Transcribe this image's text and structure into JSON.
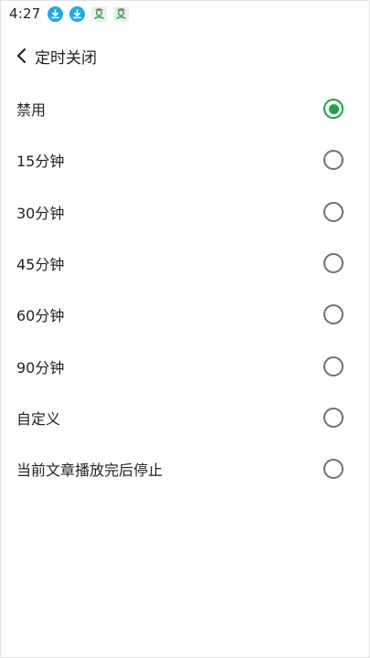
{
  "status_bar": {
    "time": "4:27",
    "icons": [
      "download-icon",
      "download-icon",
      "app-icon",
      "app-icon"
    ]
  },
  "header": {
    "title": "定时关闭"
  },
  "options": [
    {
      "label": "禁用",
      "selected": true
    },
    {
      "label": "15分钟",
      "selected": false
    },
    {
      "label": "30分钟",
      "selected": false
    },
    {
      "label": "45分钟",
      "selected": false
    },
    {
      "label": "60分钟",
      "selected": false
    },
    {
      "label": "90分钟",
      "selected": false
    },
    {
      "label": "自定义",
      "selected": false
    },
    {
      "label": "当前文章播放完后停止",
      "selected": false
    }
  ],
  "colors": {
    "accent": "#1aa34a",
    "status_icon": "#1fa9e8"
  }
}
